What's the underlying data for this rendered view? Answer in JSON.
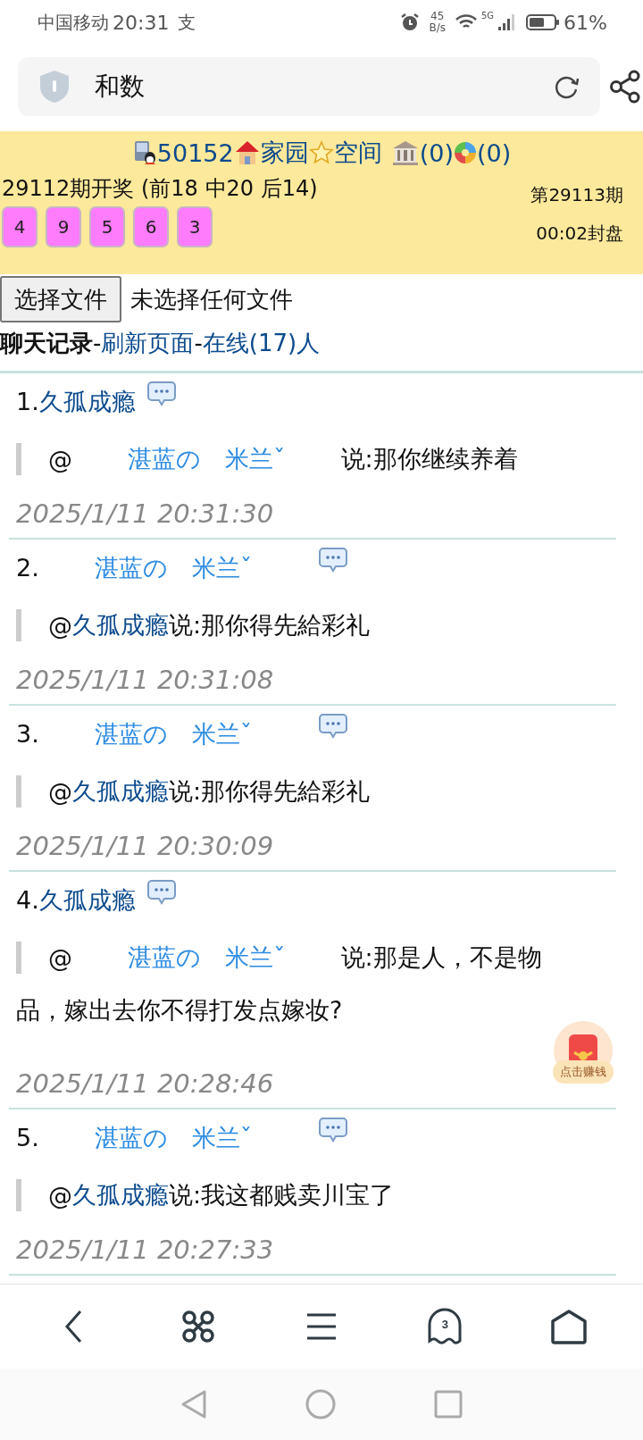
{
  "status_bar": {
    "carrier": "中国移动",
    "time": "20:31",
    "app_glyph": "支",
    "speed": "45",
    "speed_unit": "B/s",
    "network": "5G",
    "battery": "61%"
  },
  "address_bar": {
    "title": "和数"
  },
  "header": {
    "links": [
      {
        "kind": "qq",
        "label": "50152"
      },
      {
        "kind": "house",
        "label": "家园"
      },
      {
        "kind": "star",
        "label": "空间"
      },
      {
        "kind": "bank",
        "label": "(0)"
      },
      {
        "kind": "aperture",
        "label": "(0)"
      }
    ],
    "draw_title": "29112期开奖 (前18 中20 后14)",
    "balls": [
      "4",
      "9",
      "5",
      "6",
      "3"
    ],
    "next_issue": "第29113期",
    "countdown": "00:02封盘"
  },
  "file_picker": {
    "button": "选择文件",
    "status": "未选择任何文件"
  },
  "chat_heading": {
    "title": "聊天记录",
    "sep1": "-",
    "refresh": "刷新页面",
    "sep2": "-",
    "online": "在线(17)人"
  },
  "messages": [
    {
      "index": "1.",
      "author": {
        "name": "久孤成瘾",
        "kind": "plain"
      },
      "at": "@",
      "reply_to": {
        "name": "湛蓝の　米兰ˇ",
        "kind": "fancy"
      },
      "text": [
        "说:那你继续养着"
      ],
      "time": "2025/1/11 20:31:30"
    },
    {
      "index": "2.",
      "author": {
        "name": "湛蓝の　米兰ˇ",
        "kind": "fancy"
      },
      "at": "@",
      "reply_to": {
        "name": "久孤成瘾",
        "kind": "plain"
      },
      "text": [
        "说:那你得先給彩礼"
      ],
      "time": "2025/1/11 20:31:08"
    },
    {
      "index": "3.",
      "author": {
        "name": "湛蓝の　米兰ˇ",
        "kind": "fancy"
      },
      "at": "@",
      "reply_to": {
        "name": "久孤成瘾",
        "kind": "plain"
      },
      "text": [
        "说:那你得先給彩礼"
      ],
      "time": "2025/1/11 20:30:09"
    },
    {
      "index": "4.",
      "author": {
        "name": "久孤成瘾",
        "kind": "plain"
      },
      "at": "@",
      "reply_to": {
        "name": "湛蓝の　米兰ˇ",
        "kind": "fancy"
      },
      "text": [
        "说:那是人，不是物",
        "品，嫁出去你不得打发点嫁妆?"
      ],
      "time": "2025/1/11 20:28:46"
    },
    {
      "index": "5.",
      "author": {
        "name": "湛蓝の　米兰ˇ",
        "kind": "fancy"
      },
      "at": "@",
      "reply_to": {
        "name": "久孤成瘾",
        "kind": "plain"
      },
      "text": [
        "说:我这都贱卖川宝了"
      ],
      "time": "2025/1/11 20:27:33"
    }
  ],
  "float_badge": {
    "label": "点击赚钱"
  },
  "bottom_nav": {
    "tab_count": "3"
  }
}
